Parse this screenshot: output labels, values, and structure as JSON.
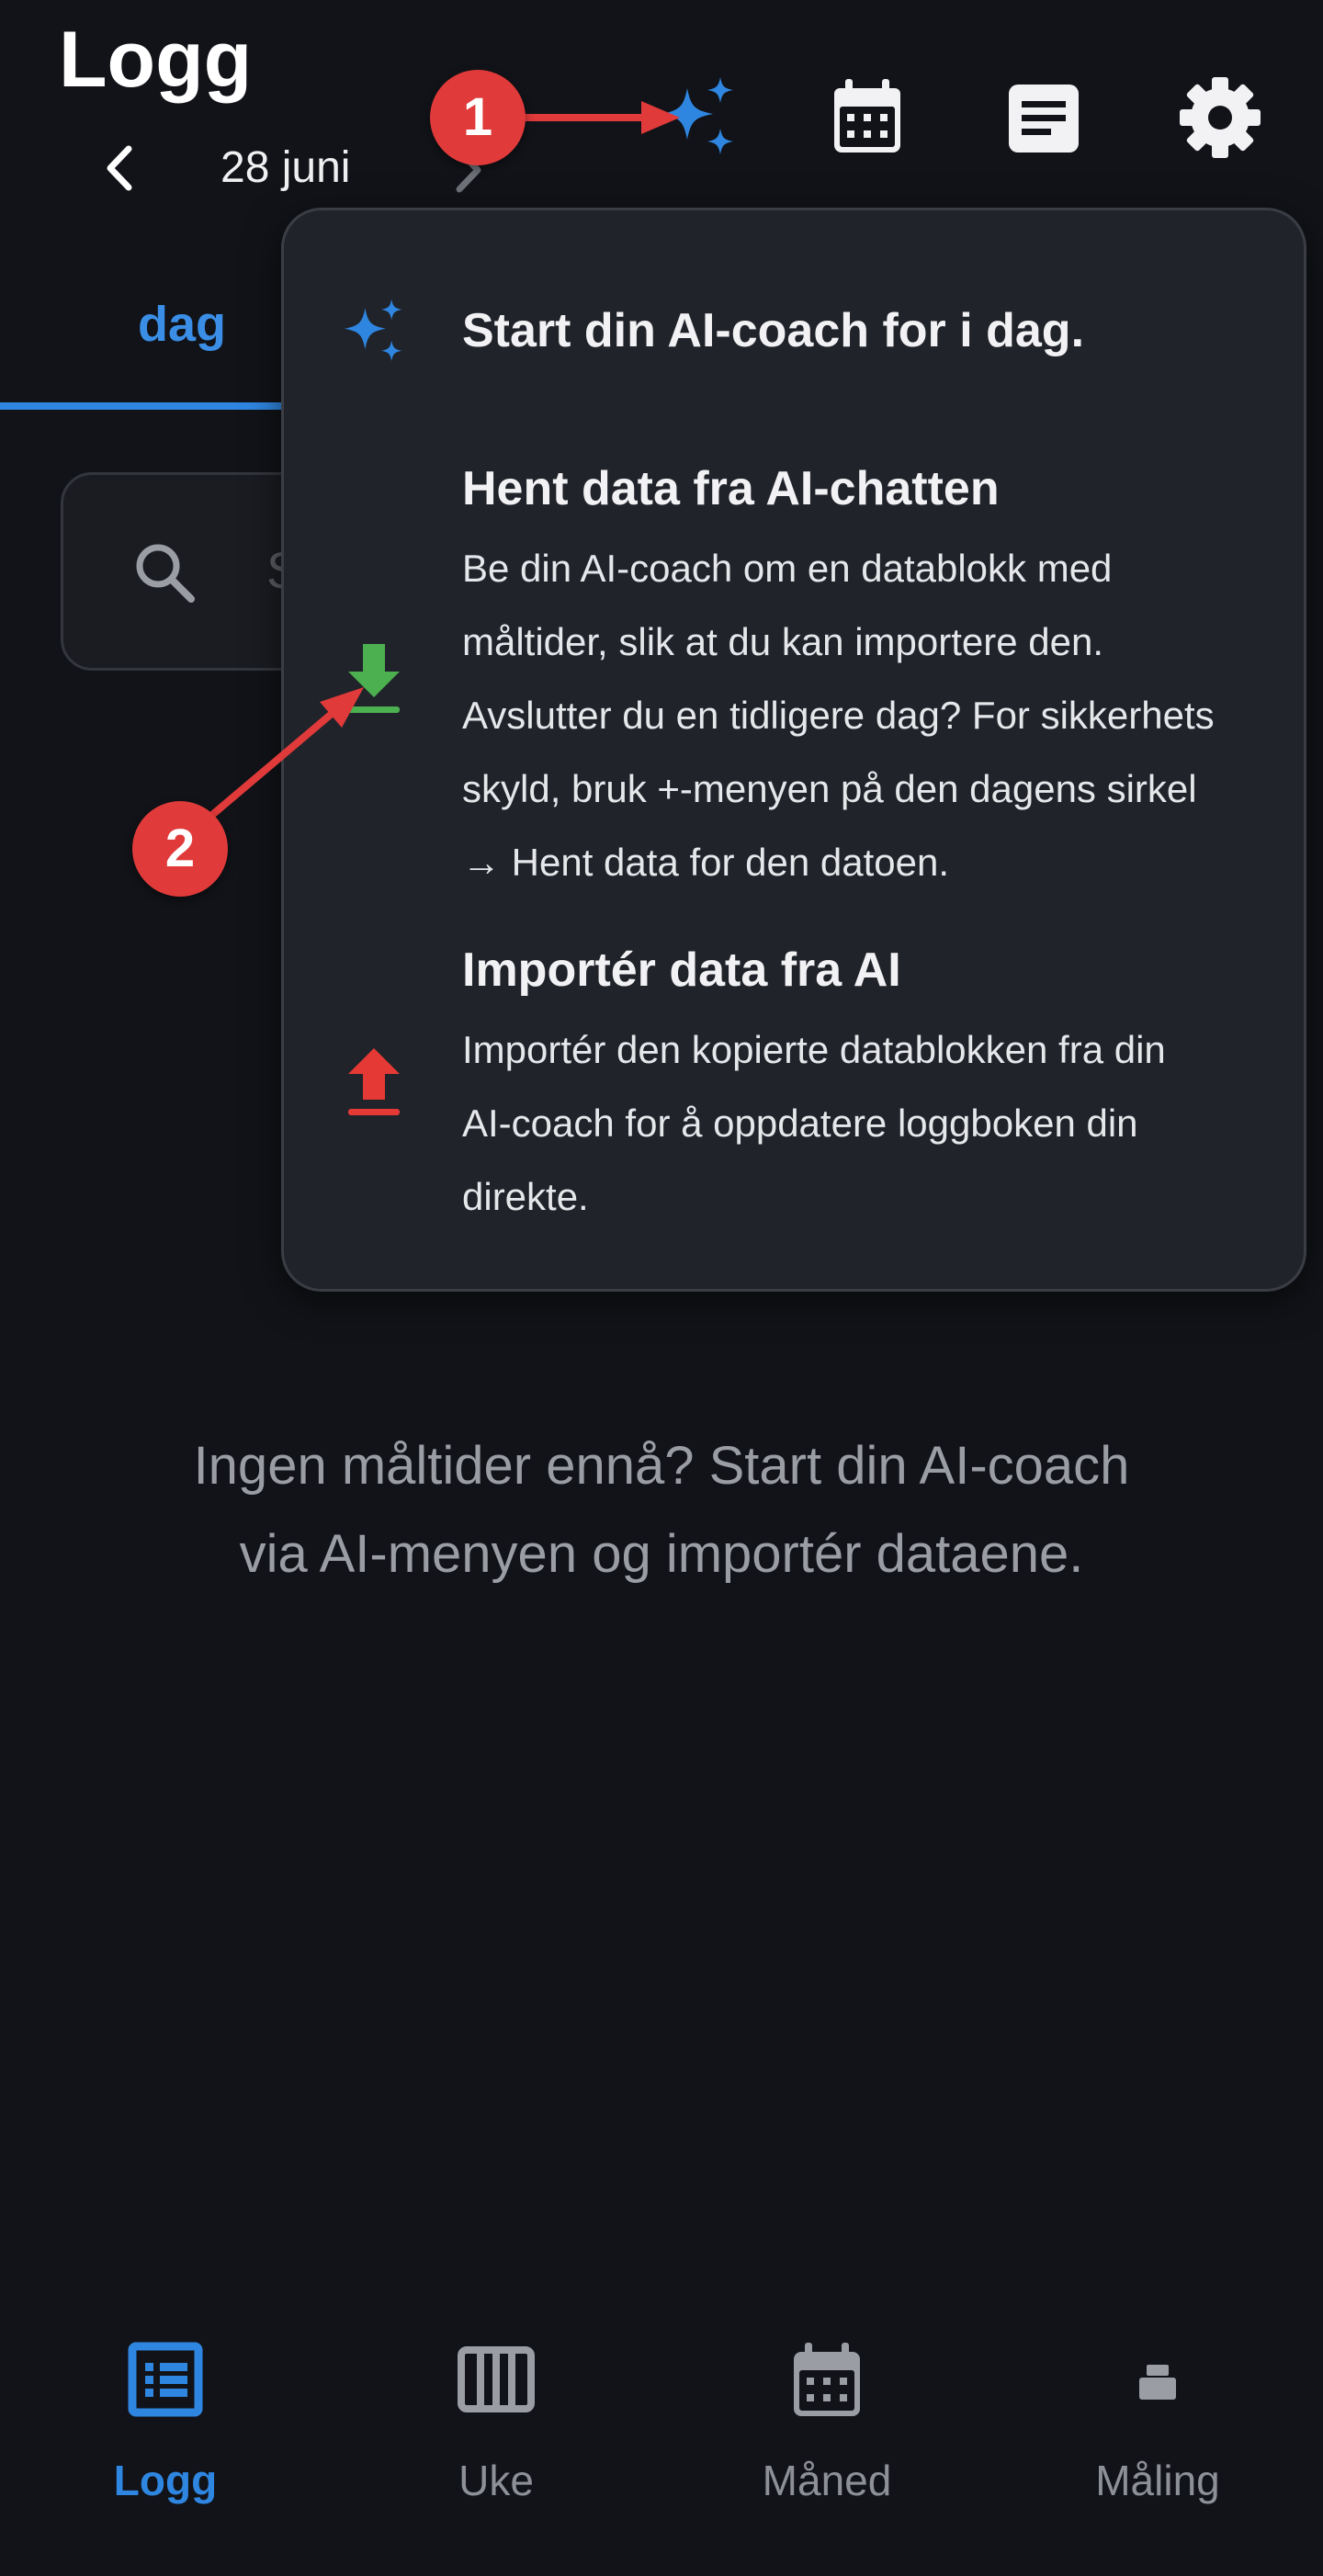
{
  "header": {
    "title": "Logg",
    "date": "28 juni"
  },
  "tabs": {
    "active": "dag"
  },
  "search": {
    "placeholder": "S"
  },
  "ai_menu": {
    "items": [
      {
        "icon": "sparkles-icon",
        "title": "Start din AI-coach for i dag."
      },
      {
        "icon": "download-icon",
        "title": "Hent data fra AI-chatten",
        "lines": [
          "Be din AI-coach om en datablokk med",
          "måltider, slik at du kan importere den.",
          "Avslutter du en tidligere dag? For sikkerhets",
          "skyld, bruk +-menyen på den dagens sirkel",
          "→ Hent data for den datoen."
        ]
      },
      {
        "icon": "upload-icon",
        "title": "Importér data fra AI",
        "lines": [
          "Importér den kopierte datablokken fra din",
          "AI-coach for å oppdatere loggboken din",
          "direkte."
        ]
      }
    ]
  },
  "empty_state": {
    "line1": "Ingen måltider ennå? Start din AI-coach",
    "line2": "via AI-menyen og importér dataene."
  },
  "bottom_nav": {
    "items": [
      {
        "label": "Logg",
        "icon": "list-icon",
        "active": true
      },
      {
        "label": "Uke",
        "icon": "week-columns-icon",
        "active": false
      },
      {
        "label": "Måned",
        "icon": "calendar-icon",
        "active": false
      },
      {
        "label": "Måling",
        "icon": "scale-icon",
        "active": false
      }
    ]
  },
  "annotations": {
    "badge1": "1",
    "badge2": "2"
  },
  "colors": {
    "background": "#111318",
    "accent_blue": "#2f86e0",
    "download_green": "#4caf50",
    "upload_red": "#e53935",
    "annotation_red": "#e03a3a"
  }
}
